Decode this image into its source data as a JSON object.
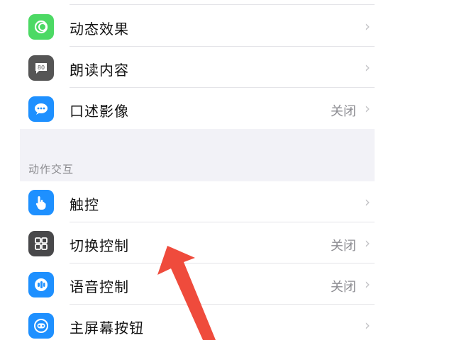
{
  "group1": [
    {
      "label": "动态效果",
      "icon": "motion-icon",
      "color": "#4cd964",
      "value": ""
    },
    {
      "label": "朗读内容",
      "icon": "speech-icon",
      "color": "#555555",
      "value": ""
    },
    {
      "label": "口述影像",
      "icon": "chat-bubble-icon",
      "color": "#1e90ff",
      "value": "关闭"
    }
  ],
  "section_header": "动作交互",
  "group2": [
    {
      "label": "触控",
      "icon": "hand-pointer-icon",
      "color": "#1e90ff",
      "value": ""
    },
    {
      "label": "切换控制",
      "icon": "grid-icon",
      "color": "#48484a",
      "value": "关闭"
    },
    {
      "label": "语音控制",
      "icon": "voice-control-icon",
      "color": "#1e90ff",
      "value": "关闭"
    },
    {
      "label": "主屏幕按钮",
      "icon": "home-button-icon",
      "color": "#1e90ff",
      "value": ""
    }
  ],
  "annotation": {
    "icon": "red-arrow-icon",
    "color": "#ef4b3c"
  }
}
